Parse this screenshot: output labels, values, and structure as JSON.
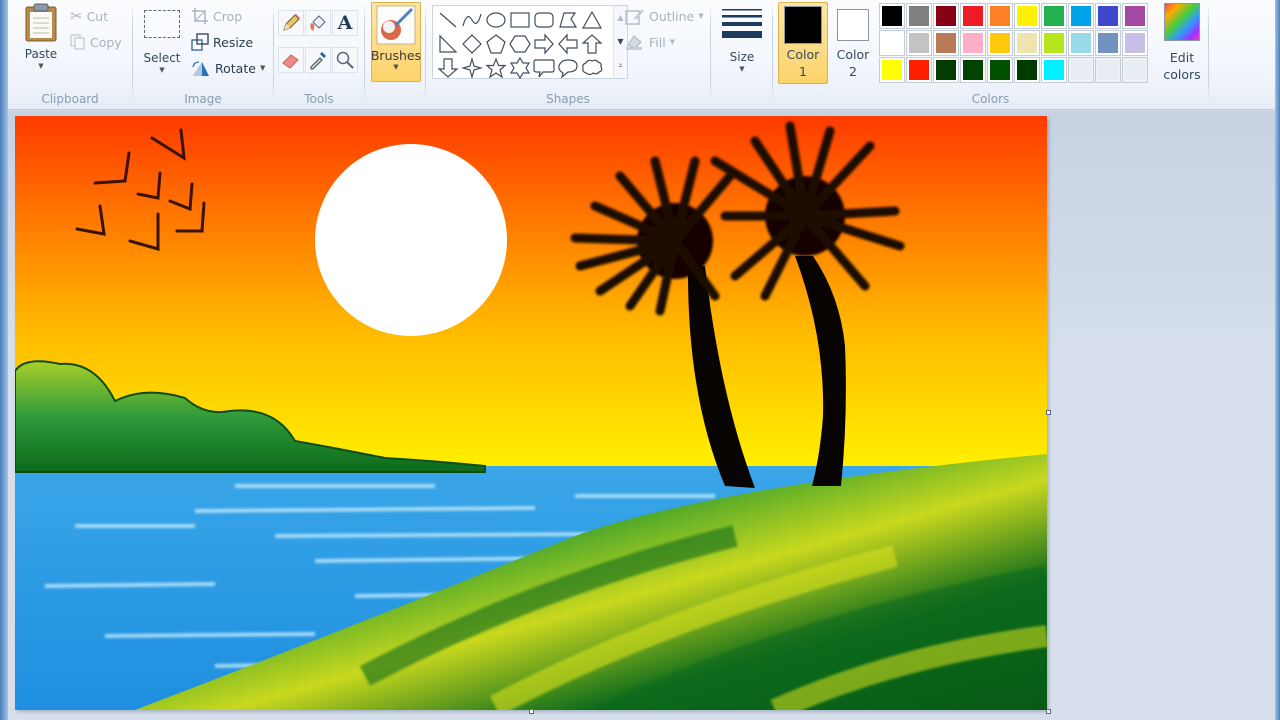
{
  "ribbon": {
    "clipboard": {
      "group_label": "Clipboard",
      "paste_label": "Paste",
      "cut_label": "Cut",
      "copy_label": "Copy"
    },
    "image": {
      "group_label": "Image",
      "select_label": "Select",
      "crop_label": "Crop",
      "resize_label": "Resize",
      "rotate_label": "Rotate"
    },
    "tools": {
      "group_label": "Tools",
      "items": [
        "pencil",
        "fill-with-color",
        "text",
        "eraser",
        "color-picker",
        "magnifier"
      ]
    },
    "brushes": {
      "label": "Brushes"
    },
    "shapes": {
      "group_label": "Shapes",
      "items": [
        "line",
        "curve",
        "oval",
        "rectangle",
        "rounded-rectangle",
        "polygon",
        "triangle",
        "right-triangle",
        "diamond",
        "pentagon",
        "hexagon",
        "right-arrow",
        "left-arrow",
        "up-arrow",
        "down-arrow",
        "four-point-star",
        "five-point-star",
        "six-point-star",
        "rounded-rectangular-callout",
        "oval-callout",
        "cloud-callout"
      ],
      "outline_label": "Outline",
      "fill_label": "Fill"
    },
    "size": {
      "label": "Size"
    },
    "colors": {
      "group_label": "Colors",
      "color1_label_line1": "Color",
      "color1_label_line2": "1",
      "color1_value": "#000000",
      "color2_label_line1": "Color",
      "color2_label_line2": "2",
      "color2_value": "#ffffff",
      "edit_colors_line1": "Edit",
      "edit_colors_line2": "colors",
      "palette": [
        "#000000",
        "#7f7f7f",
        "#880015",
        "#ed1c24",
        "#ff7f27",
        "#fff200",
        "#22b14c",
        "#00a2e8",
        "#3f48cc",
        "#a349a4",
        "#ffffff",
        "#c3c3c3",
        "#b97a57",
        "#ffaec9",
        "#ffc90e",
        "#efe4b0",
        "#b5e61d",
        "#99d9ea",
        "#7092be",
        "#c8bfe7",
        "#ffff00",
        "#ff2000",
        "#003c00",
        "#004400",
        "#005000",
        "#003c00",
        "#00f0ff",
        "",
        "",
        ""
      ]
    }
  },
  "canvas": {
    "description": "Sunset beach painting with palm trees, sun, birds, sea and green hills"
  }
}
